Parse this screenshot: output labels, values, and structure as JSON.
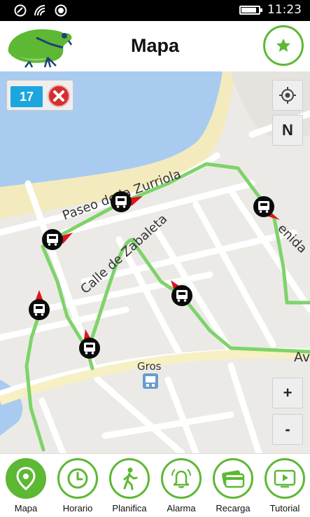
{
  "status_bar": {
    "time": "11:23"
  },
  "header": {
    "title": "Mapa",
    "favorite_icon": "star-icon"
  },
  "map": {
    "line_number": "17",
    "streets": [
      "Paseo de la Zurriola",
      "Calle de Zabaleta",
      "enida",
      "Av",
      "Gros"
    ],
    "north_label": "N",
    "zoom_in_label": "+",
    "zoom_out_label": "-",
    "route_color": "#7ed36a",
    "stop_color": "#000000",
    "direction_color": "#e0141e"
  },
  "nav": {
    "items": [
      {
        "label": "Mapa",
        "icon": "map-pin-icon",
        "active": true
      },
      {
        "label": "Horario",
        "icon": "clock-icon"
      },
      {
        "label": "Planifica",
        "icon": "walker-icon"
      },
      {
        "label": "Alarma",
        "icon": "bell-icon"
      },
      {
        "label": "Recarga",
        "icon": "card-icon"
      },
      {
        "label": "Tutorial",
        "icon": "play-icon"
      }
    ]
  },
  "accent_color": "#5db834"
}
